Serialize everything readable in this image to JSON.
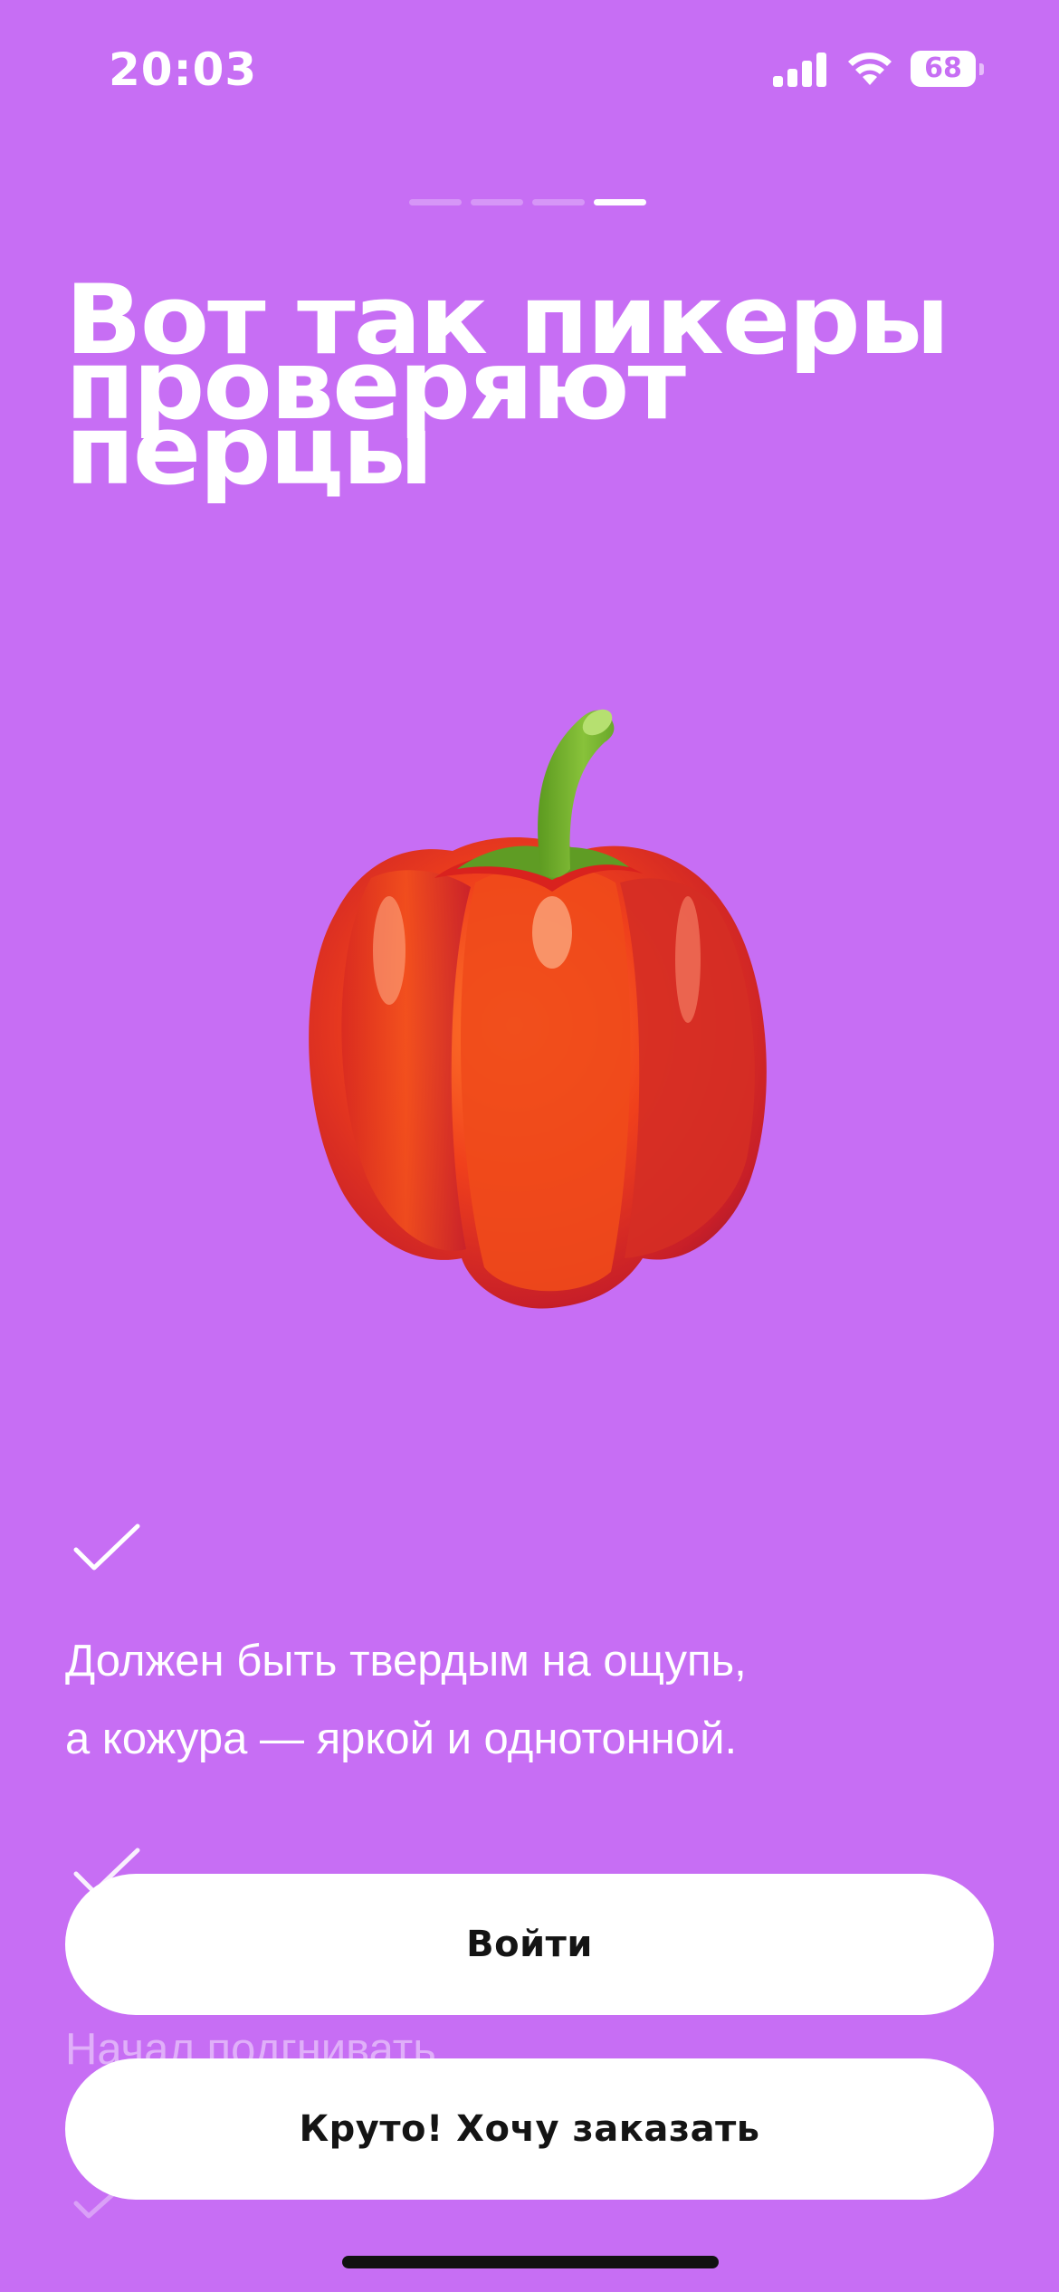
{
  "status_bar": {
    "time": "20:03",
    "battery": "68"
  },
  "onboarding": {
    "page_count": 4,
    "active_page": 4,
    "title_lines": [
      "Вот так пикеры",
      "проверяют",
      "перцы"
    ],
    "description_lines": [
      "Должен быть твердым на ощупь,",
      "а кожура — яркой и однотонной."
    ],
    "faded_text": "Начал подгнивать"
  },
  "buttons": {
    "login_label": "Войти",
    "order_label": "Круто! Хочу заказать"
  },
  "colors": {
    "background": "#c76ef4",
    "button": "#ffffff",
    "button_text": "#141414"
  },
  "icons": [
    "signal-icon",
    "wifi-icon",
    "battery-icon",
    "pepper-illustration",
    "checkmark-icon"
  ]
}
